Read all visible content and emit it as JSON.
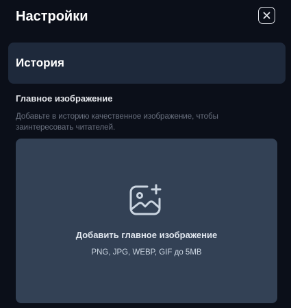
{
  "header": {
    "title": "Настройки",
    "close_icon": "close-icon"
  },
  "section": {
    "title": "История"
  },
  "main_image": {
    "label": "Главное изображение",
    "description": "Добавьте в историю качественное изображение, чтобы заинтересовать читателей.",
    "dropzone": {
      "icon": "image-add-icon",
      "title": "Добавить главное изображение",
      "hint": "PNG, JPG, WEBP, GIF до 5MB"
    }
  },
  "colors": {
    "background": "#0b0f19",
    "card": "#1e293b",
    "dropzone": "#334155",
    "muted_text": "#6b7280"
  }
}
